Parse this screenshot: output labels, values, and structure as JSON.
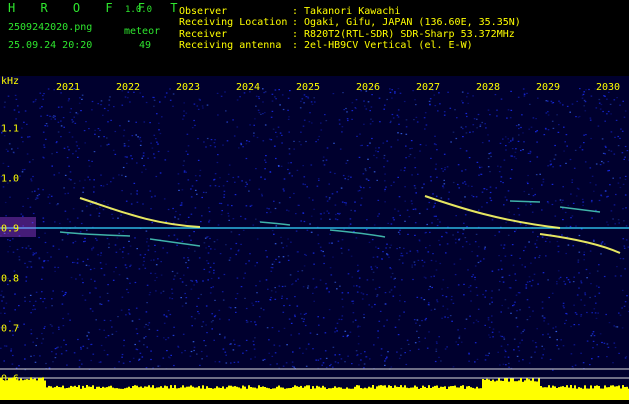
{
  "header": {
    "brand": "H R O F F T",
    "version": "1.0.0",
    "file_name": "2509242020.png",
    "datetime": "25.09.24 20:20",
    "detector": "meteor",
    "count": "49",
    "info": [
      {
        "label": "Observer",
        "value": ": Takanori Kawachi"
      },
      {
        "label": "Receiving Location",
        "value": ": Ogaki, Gifu, JAPAN (136.60E, 35.35N)"
      },
      {
        "label": "Receiver",
        "value": ": R820T2(RTL-SDR) SDR-Sharp 53.372MHz"
      },
      {
        "label": "Receiving antenna",
        "value": ": 2el-HB9CV Vertical (el. E-W)"
      }
    ]
  },
  "spectrogram": {
    "y_unit": "kHz",
    "x_ticks": [
      "2021",
      "2022",
      "2023",
      "2024",
      "2025",
      "2026",
      "2027",
      "2028",
      "2029",
      "2030"
    ],
    "y_ticks": [
      "1.1",
      "1.0",
      "0.9",
      "0.8",
      "0.7",
      "0.6"
    ],
    "colors": {
      "background": "#00002e",
      "noise": "#1a2fff",
      "carrier": "#33d6ff",
      "trace": "#ffff66",
      "level": "#ffff00",
      "guide": "#dddddd",
      "label": "#ffff00"
    }
  }
}
